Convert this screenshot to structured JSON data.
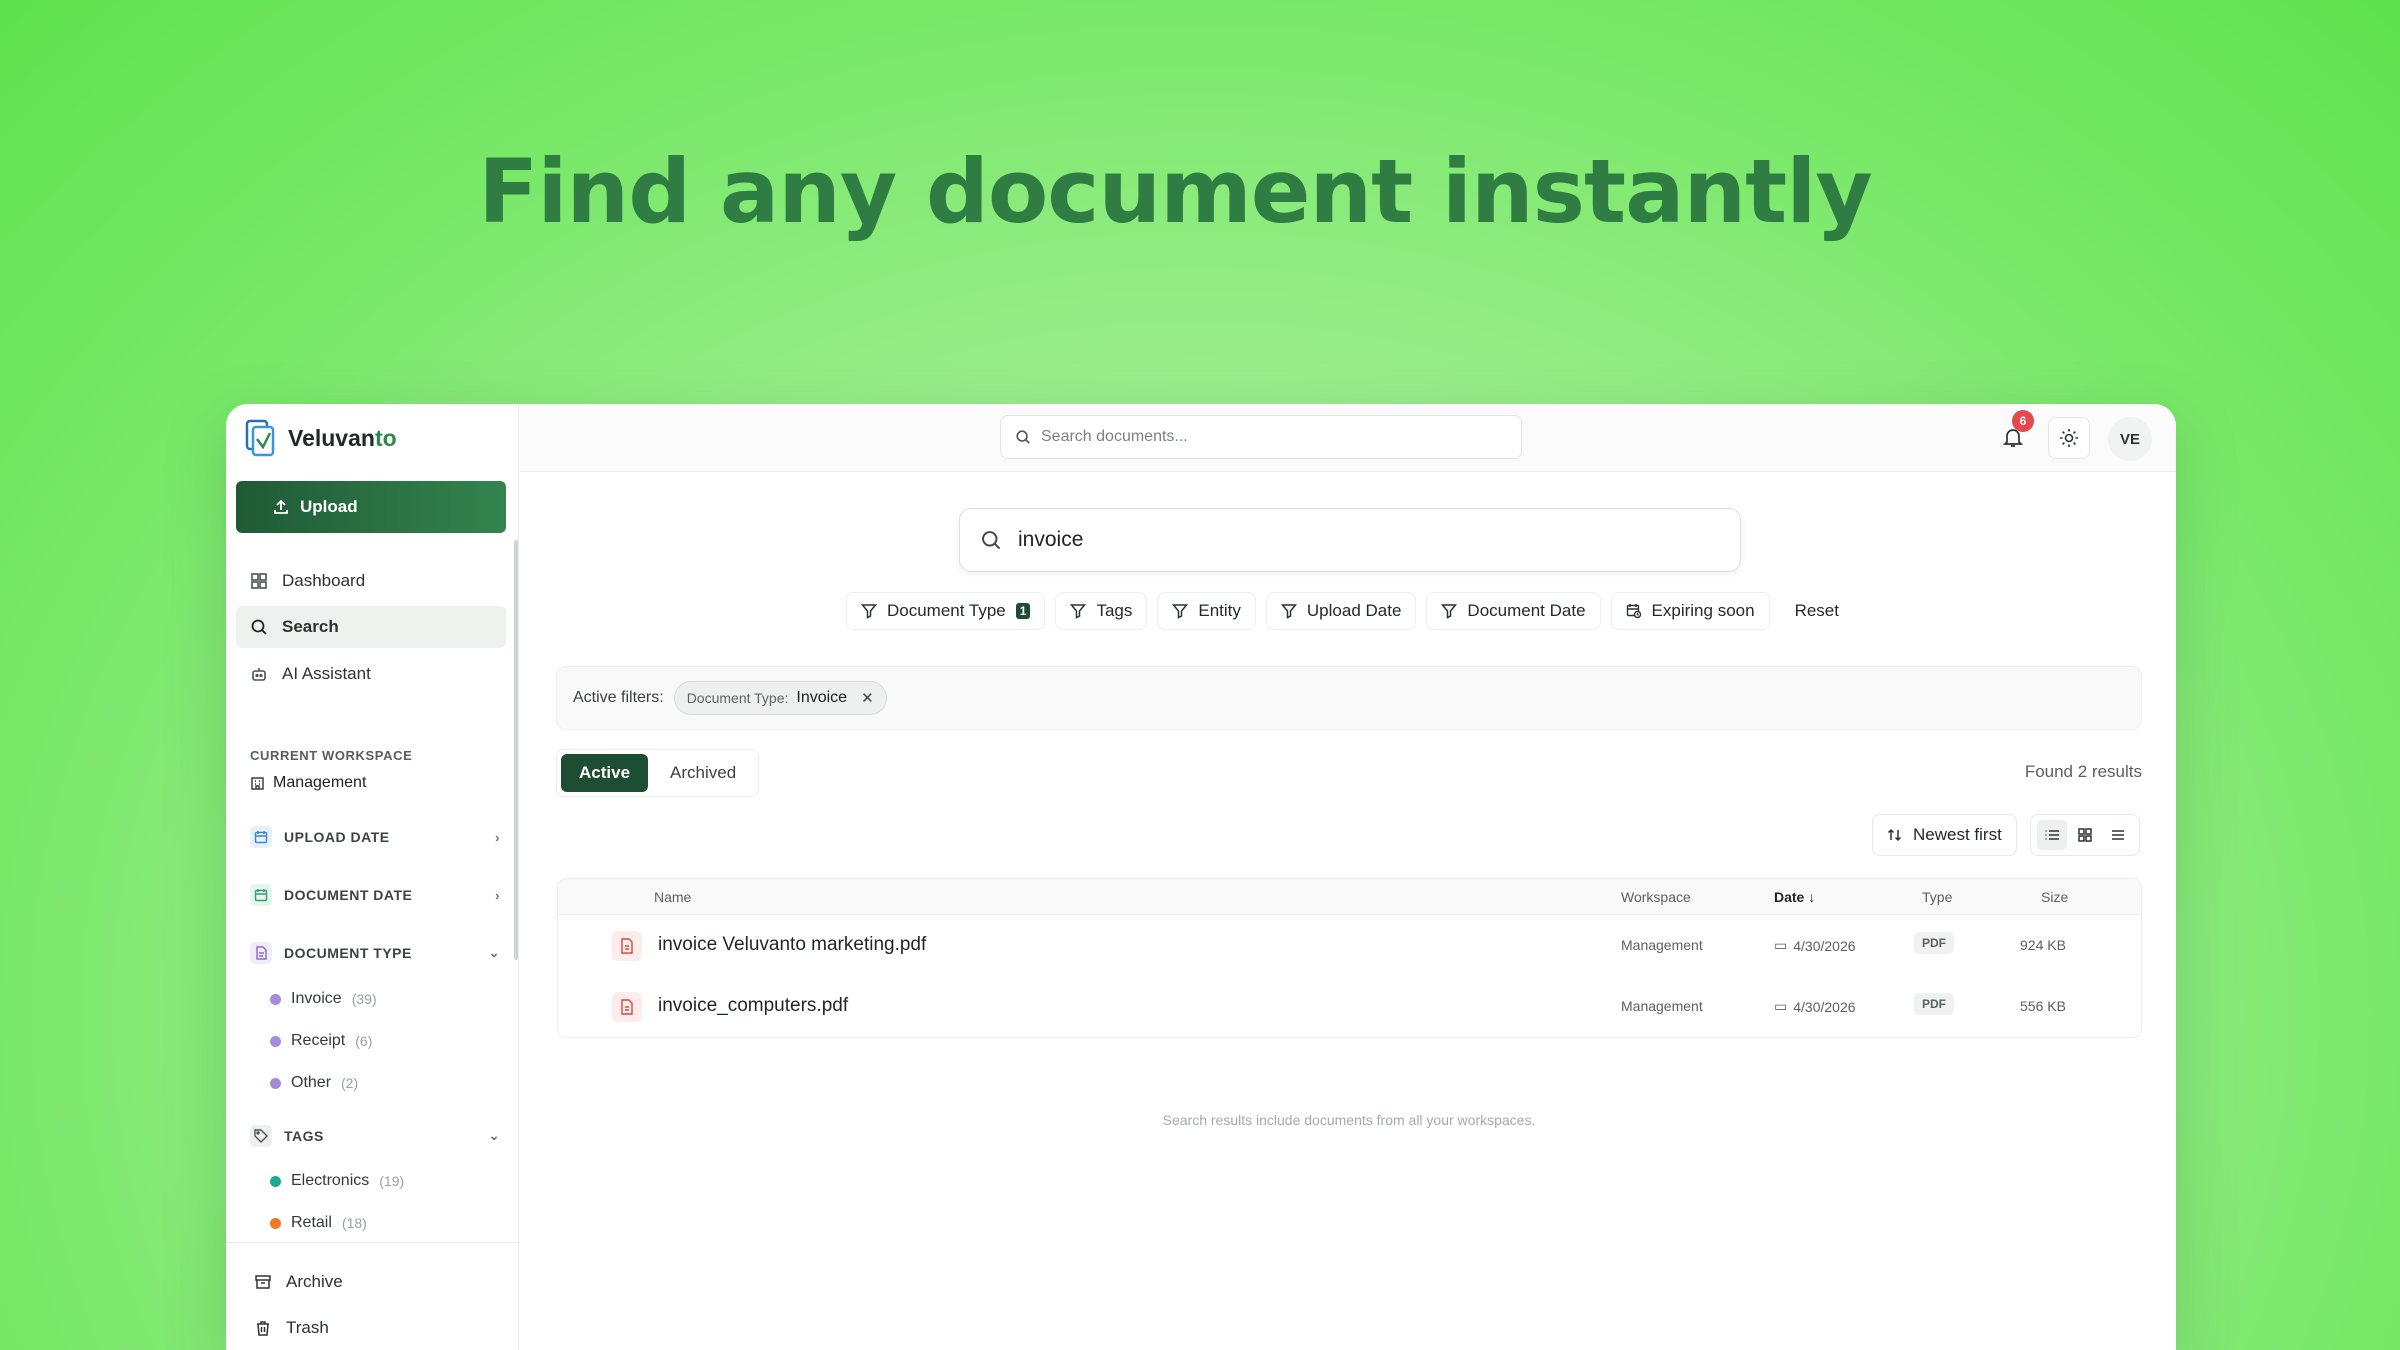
{
  "hero": {
    "title": "Find any document instantly"
  },
  "app": {
    "name_main": "Veluvan",
    "name_accent": "to"
  },
  "sidebar": {
    "upload_label": "Upload",
    "nav": [
      {
        "label": "Dashboard",
        "icon": "grid-icon"
      },
      {
        "label": "Search",
        "icon": "search-icon"
      },
      {
        "label": "AI Assistant",
        "icon": "bot-icon"
      }
    ],
    "workspace_label": "CURRENT WORKSPACE",
    "workspace_name": "Management",
    "filters": {
      "upload_date": "UPLOAD DATE",
      "document_date": "DOCUMENT DATE",
      "document_type": "DOCUMENT TYPE",
      "tags": "TAGS"
    },
    "doc_types": [
      {
        "label": "Invoice",
        "count": "(39)",
        "color": "#a78bdb"
      },
      {
        "label": "Receipt",
        "count": "(6)",
        "color": "#a78bdb"
      },
      {
        "label": "Other",
        "count": "(2)",
        "color": "#a78bdb"
      }
    ],
    "tags": [
      {
        "label": "Electronics",
        "count": "(19)",
        "color": "#1fa88f"
      },
      {
        "label": "Retail",
        "count": "(18)",
        "color": "#ec7a2c"
      }
    ],
    "archive": "Archive",
    "trash": "Trash"
  },
  "topbar": {
    "search_placeholder": "Search documents...",
    "notifications": "6",
    "avatar": "VE"
  },
  "main": {
    "query": "invoice",
    "filters": [
      {
        "label": "Document Type",
        "count": "1"
      },
      {
        "label": "Tags"
      },
      {
        "label": "Entity"
      },
      {
        "label": "Upload Date"
      },
      {
        "label": "Document Date"
      },
      {
        "label": "Expiring soon"
      }
    ],
    "reset": "Reset",
    "active_filters_label": "Active filters:",
    "active_filter": {
      "key": "Document Type:",
      "value": "Invoice"
    },
    "tabs": {
      "active": "Active",
      "archived": "Archived"
    },
    "found": "Found 2 results",
    "sort": "Newest first",
    "columns": {
      "name": "Name",
      "workspace": "Workspace",
      "date": "Date ↓",
      "type": "Type",
      "size": "Size"
    },
    "rows": [
      {
        "name": "invoice Veluvanto marketing.pdf",
        "workspace": "Management",
        "date": "4/30/2026",
        "type": "PDF",
        "size": "924 KB"
      },
      {
        "name": "invoice_computers.pdf",
        "workspace": "Management",
        "date": "4/30/2026",
        "type": "PDF",
        "size": "556 KB"
      }
    ],
    "footnote": "Search results include documents from all your workspaces."
  }
}
